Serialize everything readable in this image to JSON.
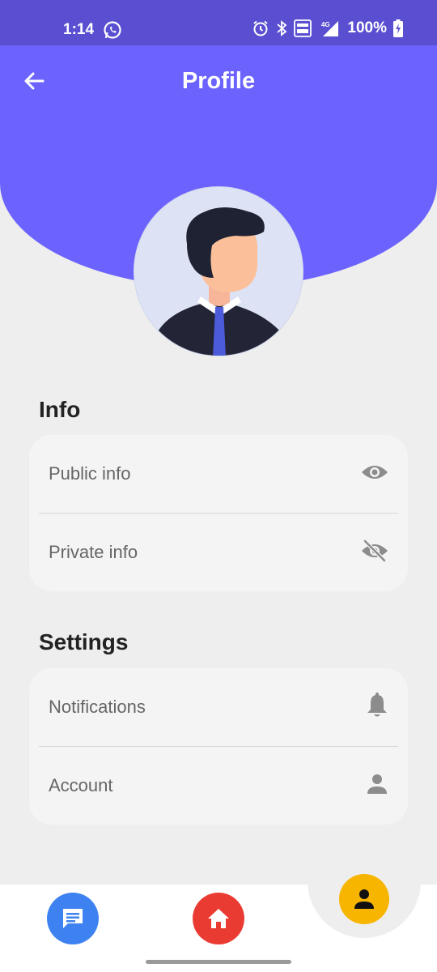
{
  "status_bar": {
    "time": "1:14",
    "battery": "100%",
    "icons": [
      "whatsapp-icon",
      "alarm-icon",
      "bluetooth-icon",
      "volte-icon",
      "4g-signal-icon",
      "battery-charging-icon"
    ]
  },
  "header": {
    "title": "Profile",
    "back_icon": "arrow-left-icon",
    "background_color": "#6c63ff"
  },
  "info_section": {
    "title": "Info",
    "items": [
      {
        "label": "Public info",
        "icon": "eye-icon"
      },
      {
        "label": "Private info",
        "icon": "eye-off-icon"
      }
    ]
  },
  "settings_section": {
    "title": "Settings",
    "items": [
      {
        "label": "Notifications",
        "icon": "bell-icon"
      },
      {
        "label": "Account",
        "icon": "person-icon"
      }
    ]
  },
  "bottom_nav": {
    "items": [
      {
        "name": "chat",
        "icon": "chat-icon",
        "color": "#3d82f0"
      },
      {
        "name": "home",
        "icon": "home-icon",
        "color": "#ea3b33"
      },
      {
        "name": "profile",
        "icon": "person-icon",
        "color": "#f7b500",
        "active": true
      }
    ]
  }
}
